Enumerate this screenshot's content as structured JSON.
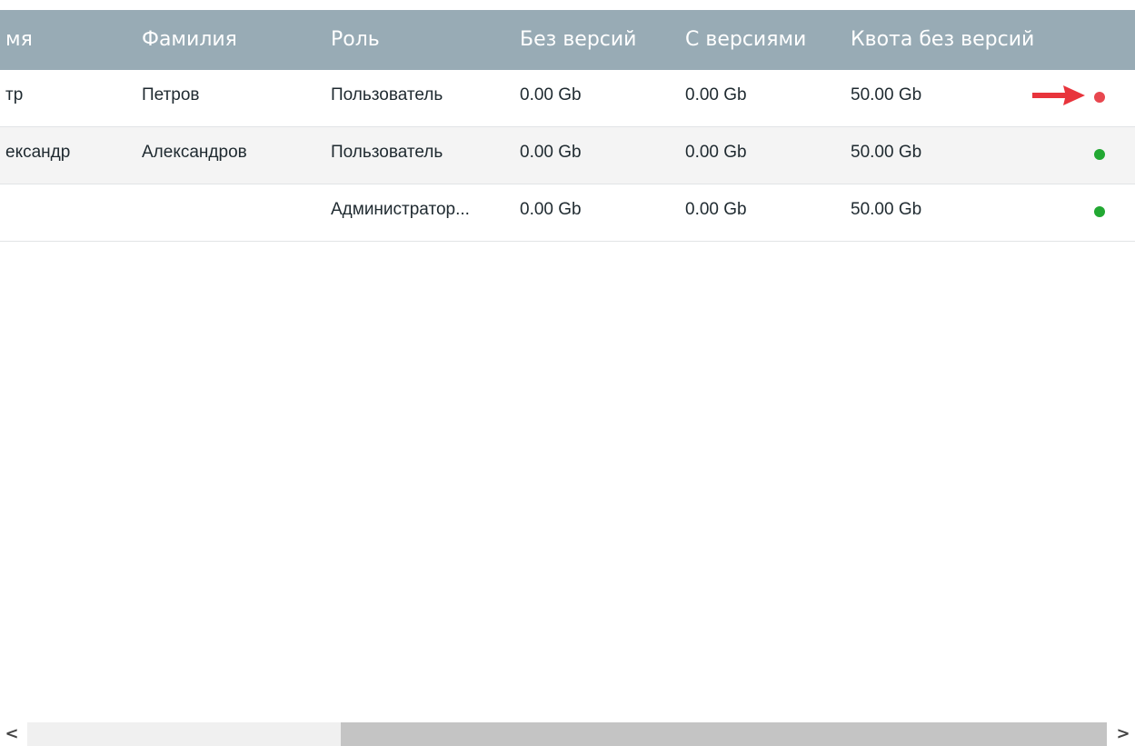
{
  "table": {
    "columns": [
      {
        "key": "first_name",
        "label": "мя"
      },
      {
        "key": "last_name",
        "label": "Фамилия"
      },
      {
        "key": "role",
        "label": "Роль"
      },
      {
        "key": "no_versions",
        "label": "Без версий"
      },
      {
        "key": "with_versions",
        "label": "С версиями"
      },
      {
        "key": "quota_no_versions",
        "label": "Квота без версий"
      }
    ],
    "rows": [
      {
        "first_name": "тр",
        "last_name": "Петров",
        "role": "Пользователь",
        "no_versions": "0.00 Gb",
        "with_versions": "0.00 Gb",
        "quota_no_versions": "50.00 Gb",
        "status": "inactive"
      },
      {
        "first_name": "ександр",
        "last_name": "Александров",
        "role": "Пользователь",
        "no_versions": "0.00 Gb",
        "with_versions": "0.00 Gb",
        "quota_no_versions": "50.00 Gb",
        "status": "active"
      },
      {
        "first_name": "",
        "last_name": "",
        "role": "Администратор...",
        "no_versions": "0.00 Gb",
        "with_versions": "0.00 Gb",
        "quota_no_versions": "50.00 Gb",
        "status": "active"
      }
    ]
  },
  "status_colors": {
    "active": "#22a832",
    "inactive": "#e8474f"
  },
  "annotation": {
    "icon": "arrow-right-icon",
    "color": "#e8343c"
  },
  "scrollbar": {
    "left_icon": "chevron-left-icon",
    "left_glyph": "<",
    "right_icon": "chevron-right-icon",
    "right_glyph": ">",
    "position_fraction": 0.29,
    "visible_fraction": 0.71
  },
  "colors": {
    "header_bg": "#98abb5",
    "row_alt_bg": "#f4f4f4"
  }
}
